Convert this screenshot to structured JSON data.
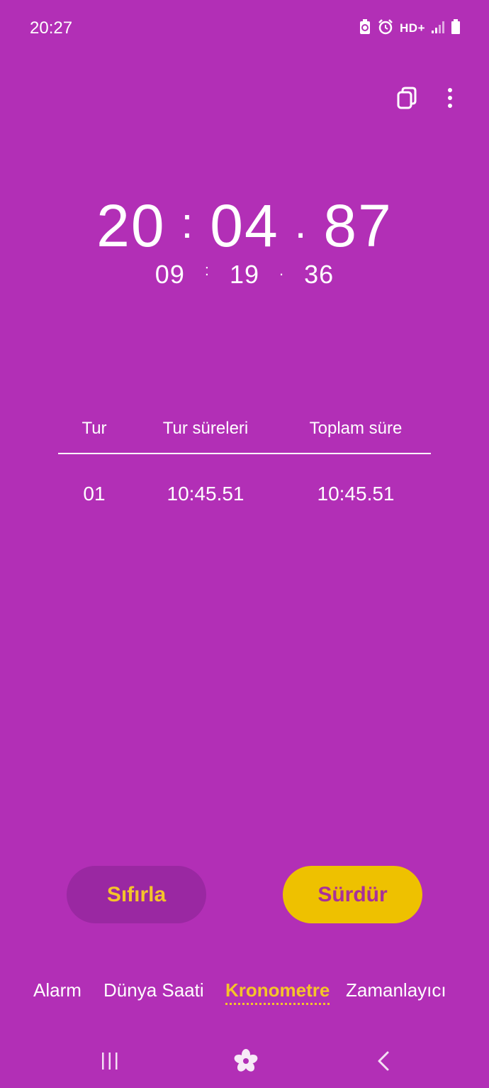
{
  "status_bar": {
    "time": "20:27",
    "network": "HD+"
  },
  "stopwatch": {
    "main": {
      "minutes": "20",
      "sep1": ":",
      "seconds": "04",
      "sep2": ".",
      "hundredths": "87"
    },
    "lap": {
      "minutes": "09",
      "sep1": ":",
      "seconds": "19",
      "sep2": ".",
      "hundredths": "36"
    }
  },
  "lap_table": {
    "headers": [
      "Tur",
      "Tur süreleri",
      "Toplam süre"
    ],
    "rows": [
      {
        "lap": "01",
        "lap_time": "10:45.51",
        "total_time": "10:45.51"
      }
    ]
  },
  "buttons": {
    "reset_label": "Sıfırla",
    "resume_label": "Sürdür"
  },
  "tabs": [
    {
      "label": "Alarm"
    },
    {
      "label": "Dünya Saati"
    },
    {
      "label": "Kronometre",
      "active": true
    },
    {
      "label": "Zamanlayıcı"
    }
  ],
  "colors": {
    "background": "#B22FB6",
    "accent": "#F5C42A",
    "resume_button": "#EEC100",
    "reset_button": "#9A28A2"
  },
  "icons": [
    "battery-saver-icon",
    "alarm-icon",
    "signal-icon",
    "battery-icon",
    "copy-icon",
    "more-options-icon",
    "recents-icon",
    "home-icon",
    "back-icon"
  ]
}
